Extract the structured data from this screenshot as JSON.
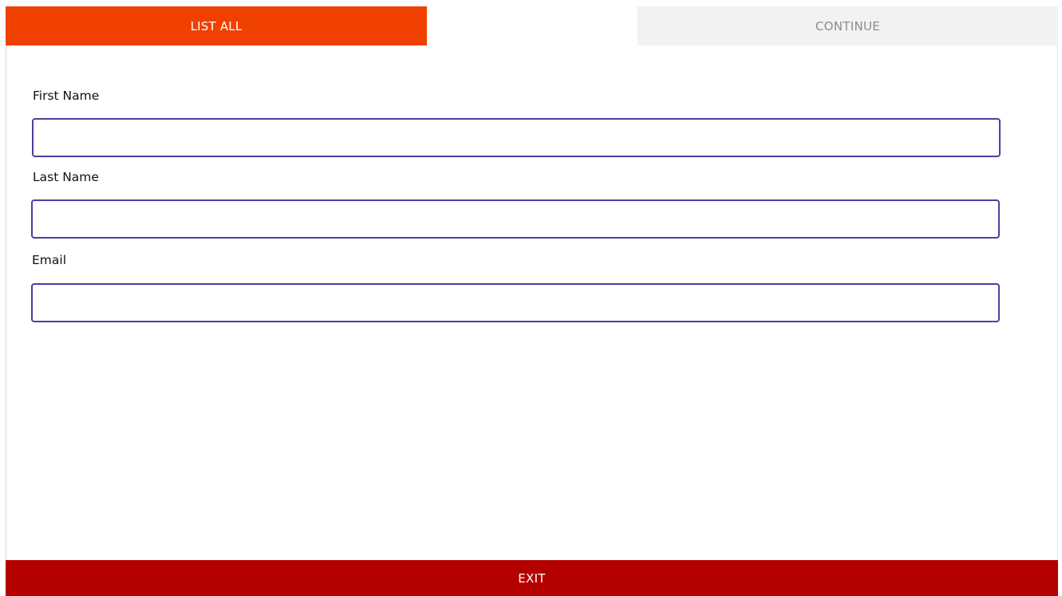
{
  "tabs": {
    "list_all": "LIST ALL",
    "continue": "CONTINUE"
  },
  "form": {
    "first_name": {
      "label": "First Name",
      "value": ""
    },
    "last_name": {
      "label": "Last Name",
      "value": ""
    },
    "email": {
      "label": "Email",
      "value": ""
    }
  },
  "footer": {
    "exit_label": "EXIT"
  },
  "colors": {
    "list_all_tab": "#f04100",
    "continue_tab": "#f2f2f2",
    "input_border": "#4b3fa0",
    "exit_button": "#b50000"
  }
}
